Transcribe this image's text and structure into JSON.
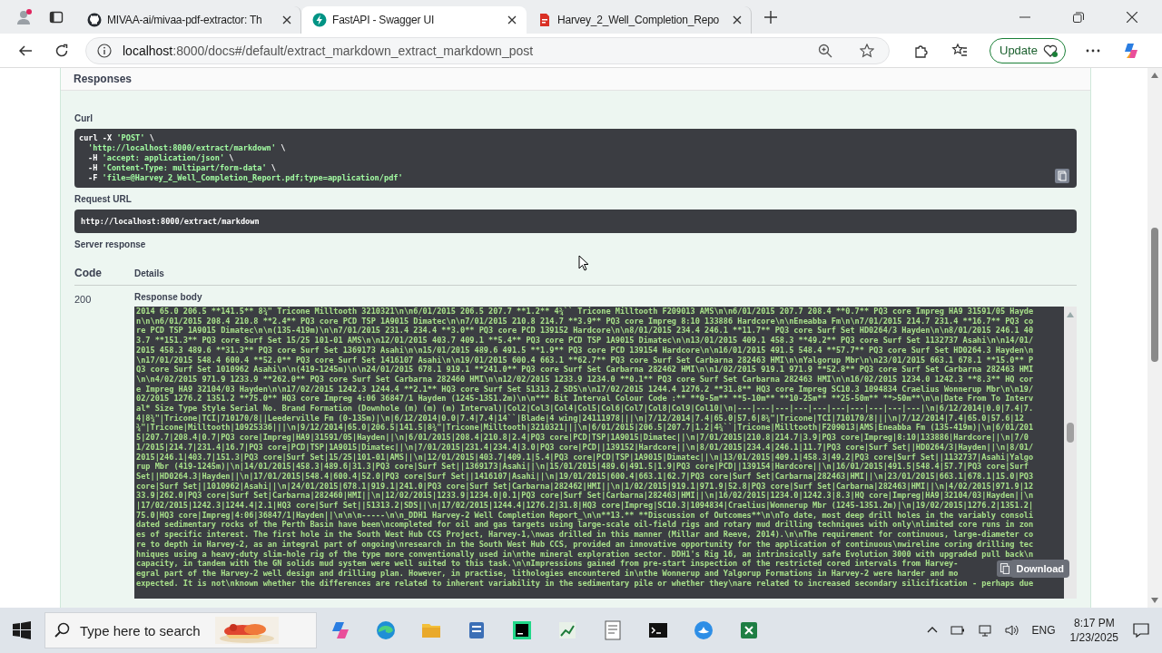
{
  "browser": {
    "tabs": [
      {
        "title": "MIVAA-ai/mivaa-pdf-extractor: Th",
        "selected": false,
        "kind": "repo"
      },
      {
        "title": "FastAPI - Swagger UI",
        "selected": true,
        "kind": "api"
      },
      {
        "title": "Harvey_2_Well_Completion_Repo",
        "selected": false,
        "kind": "pdf"
      }
    ],
    "address": {
      "host": "localhost",
      "path": ":8000/docs#/default/extract_markdown_extract_markdown_post"
    },
    "update_button": "Update"
  },
  "swagger": {
    "section_title": "Responses",
    "curl_label": "Curl",
    "curl_lines": [
      [
        {
          "text": "curl -X ",
          "kind": "plain"
        },
        {
          "text": "'POST'",
          "kind": "string"
        },
        {
          "text": " \\",
          "kind": "plain"
        }
      ],
      [
        {
          "text": "'http://localhost:8000/extract/markdown'",
          "kind": "string"
        },
        {
          "text": " \\",
          "kind": "plain"
        }
      ],
      [
        {
          "text": "-H ",
          "kind": "plain"
        },
        {
          "text": "'accept: application/json'",
          "kind": "string"
        },
        {
          "text": " \\",
          "kind": "plain"
        }
      ],
      [
        {
          "text": "-H ",
          "kind": "plain"
        },
        {
          "text": "'Content-Type: multipart/form-data'",
          "kind": "string"
        },
        {
          "text": " \\",
          "kind": "plain"
        }
      ],
      [
        {
          "text": "-F ",
          "kind": "plain"
        },
        {
          "text": "'file=@Harvey_2_Well_Completion_Report.pdf;type=application/pdf'",
          "kind": "string"
        }
      ]
    ],
    "request_url_label": "Request URL",
    "request_url": "http://localhost:8000/extract/markdown",
    "server_response_label": "Server response",
    "columns": [
      "Code",
      "Details"
    ],
    "code": "200",
    "response_body_label": "Response body",
    "response_body_lines": [
      "2014 65.0 206.5 **141.5** 8¾\" Tricone Milltooth 3210321\\n\\n6/01/2015 206.5 207.7 **1.2** 4¾`` Tricone Milltooth F209013 AMS\\n\\n6/01/2015 207.7 208.4 **0.7** PQ3 core Impreg HA9 31591/05 Hayde",
      "n\\n\\n6/01/2015 208.4 210.8 **2.4** PQ3 core PCD TSP 1A9015 Dimatec\\n\\n7/01/2015 210.8 214.7 **3.9** PQ3 core Impreg 8:10 133886 Hardcore\\n\\nEneabba Fm\\n\\n7/01/2015 214.7 231.4 **16.7** PQ3 co",
      "re PCD TSP 1A9015 Dimatec\\n\\n(135-419m)\\n\\n7/01/2015 231.4 234.4 **3.0** PQ3 core PCD 139152 Hardcore\\n\\n8/01/2015 234.4 246.1 **11.7** PQ3 core Surf Set HD0264/3 Hayden\\n\\n8/01/2015 246.1 40",
      "3.7 **151.3** PQ3 core Surf Set 15/25 101-01 AMS\\n\\n12/01/2015 403.7 409.1 **5.4** PQ3 core PCD TSP 1A9015 Dimatec\\n\\n13/01/2015 409.1 458.3 **49.2** PQ3 core Surf Set 1132737 Asahi\\n\\n14/01/",
      "2015 458.3 489.6 **31.3** PQ3 core Surf Set 1369173 Asahi\\n\\n15/01/2015 489.6 491.5 **1.9** PQ3 core PCD 139154 Hardcore\\n\\n16/01/2015 491.5 548.4 **57.7** PQ3 core Surf Set HD0264.3 Hayden\\n",
      "\\n17/01/2015 548.4 600.4 **52.0** PQ3 core Surf Set 1416107 Asahi\\n\\n19/01/2015 600.4 663.1 **62.7** PQ3 core Surf Set Carbarna 282463 HMI\\n\\nYalgorup Mbr\\n\\n23/01/2015 663.1 678.1 **15.0** P",
      "Q3 core Surf Set 1010962 Asahi\\n\\n(419-1245m)\\n\\n24/01/2015 678.1 919.1 **241.0** PQ3 core Surf Set Carbarna 282462 HMI\\n\\n1/02/2015 919.1 971.9 **52.8** PQ3 core Surf Set Carbarna 282463 HMI",
      "\\n\\n4/02/2015 971.9 1233.9 **262.0** PQ3 core Surf Set Carbarna 282460 HMI\\n\\n12/02/2015 1233.9 1234.0 **0.1** PQ3 core Surf Set Carbarna 282463 HMI\\n\\n16/02/2015 1234.0 1242.3 **8.3** HQ cor",
      "e Impreg HA9 32104/03 Hayden\\n\\n17/02/2015 1242.3 1244.4 **2.1** HQ3 core Surf Set 51313.2 SDS\\n\\n17/02/2015 1244.4 1276.2 **31.8** HQ3 core Impreg SC10.3 1094834 Craelius Wonnerup Mbr\\n\\n19/",
      "02/2015 1276.2 1351.2 **75.0** HQ3 core Impreg 4:06 36847/1 Hayden (1245-1351.2m)\\n\\n*** Bit Interval Colour Code :** **0-5m** **5-10m** **10-25m** **25-50m** **>50m**\\n\\n|Date From To Interv",
      "al* Size Type Style Serial No. Brand Formation (Downhole (m) (m) (m) Interval)|Col2|Col3|Col4|Col5|Col6|Col7|Col8|Col9|Col10|\\n|---|---|---|---|---|---|---|---|---|---|\\n|6/12/2014|0.0|7.4|7.",
      "4|8¾\"|Tricone|TCI|710170/8||Leederville Fm (0-135m)|\\n|6/12/2014|0.0|7.4|7.4|14``|Blade|4 wing|24111978|||\\n|7/12/2014|7.4|65.0|57.6|8¾\"|Tricone|TCI|710170/8|||\\n|7/12/2014|7.4|65.0|57.6|12",
      "¾\"|Tricone|Milltooth|10925336|||\\n|9/12/2014|65.0|206.5|141.5|8¾\"|Tricone|Milltooth|3210321|||\\n|6/01/2015|206.5|207.7|1.2|4¾``|Tricone|Milltooth|F209013|AMS|Eneabba Fm (135-419m)|\\n|6/01/201",
      "5|207.7|208.4|0.7|PQ3 core|Impreg|HA9|31591/05|Hayden||\\n|6/01/2015|208.4|210.8|2.4|PQ3 core|PCD|TSP|1A9015|Dimatec||\\n|7/01/2015|210.8|214.7|3.9|PQ3 core|Impreg|8:10|133886|Hardcore||\\n|7/0",
      "1/2015|214.7|231.4|16.7|PQ3 core|PCD|TSP|1A9015|Dimatec||\\n|7/01/2015|231.4|234.4|3.0|PQ3 core|PCD||139152|Hardcore||\\n|8/01/2015|234.4|246.1|11.7|PQ3 core|Surf Set||HD0264/3|Hayden||\\n|8/01/",
      "2015|246.1|403.7|151.3|PQ3 core|Surf Set|15/25|101-01|AMS||\\n|12/01/2015|403.7|409.1|5.4|PQ3 core|PCD|TSP|1A9015|Dimatec||\\n|13/01/2015|409.1|458.3|49.2|PQ3 core|Surf Set||1132737|Asahi|Yalgo",
      "rup Mbr (419-1245m)|\\n|14/01/2015|458.3|489.6|31.3|PQ3 core|Surf Set||1369173|Asahi||\\n|15/01/2015|489.6|491.5|1.9|PQ3 core|PCD||139154|Hardcore||\\n|16/01/2015|491.5|548.4|57.7|PQ3 core|Surf",
      "Set||HD0264.3|Hayden||\\n|17/01/2015|548.4|600.4|52.0|PQ3 core|Surf Set||1416107|Asahi||\\n|19/01/2015|600.4|663.1|62.7|PQ3 core|Surf Set|Carbarna|282463|HMI||\\n|23/01/2015|663.1|678.1|15.0|PQ3",
      "core|Surf Set||1010962|Asahi||\\n|24/01/2015|678.1|919.1|241.0|PQ3 core|Surf Set|Carbarna|282462|HMI||\\n|1/02/2015|919.1|971.9|52.8|PQ3 core|Surf Set|Carbarna|282463|HMI||\\n|4/02/2015|971.9|12",
      "33.9|262.0|PQ3 core|Surf Set|Carbarna|282460|HMI||\\n|12/02/2015|1233.9|1234.0|0.1|PQ3 core|Surf Set|Carbarna|282463|HMI||\\n|16/02/2015|1234.0|1242.3|8.3|HQ core|Impreg|HA9|32104/03|Hayden||\\n",
      "|17/02/2015|1242.3|1244.4|2.1|HQ3 core|Surf Set||51313.2|SDS||\\n|17/02/2015|1244.4|1276.2|31.8|HQ3 core|Impreg|SC10.3|1094834|Craelius|Wonnerup Mbr (1245-1351.2m)|\\n|19/02/2015|1276.2|1351.2|",
      "75.0|HQ3 core|Impreg|4:06|36847/1|Hayden||\\n\\n\\n-----\\n\\n_DDH1 Harvey-2 Well Completion Report_\\n\\n**13.** **Discussion of Outcomes**\\n\\nTo date, most deep drill holes in the variably consoli",
      "dated sedimentary rocks of the Perth Basin have been\\ncompleted for oil and gas targets using large-scale oil-field rigs and rotary mud drilling techniques with only\\nlimited core runs in zon",
      "es of specific interest. The first hole in the South West Hub CCS Project, Harvey-1,\\nwas drilled in this manner (Millar and Reeve, 2014).\\n\\nThe requirement for continuous, large-diameter co",
      "re to depth in Harvey-2, as an integral part of ongoing\\nresearch in the South West Hub CCS, provided an innovative opportunity for the application of continuous\\nwireline coring drilling tec",
      "hniques using a heavy-duty slim-hole rig of the type more conventionally used in\\nthe mineral exploration sector. DDH1's Rig 16, an intrinsically safe Evolution 3000 with upgraded pull back\\n",
      "capacity, in tandem with the GN solids mud system were well suited to this task.\\n\\nImpressions gained from pre-start inspection of the restricted cored intervals from Harvey-",
      "egral part of the Harvey-2 well design and drilling plan. However, in practise, lithologies encountered in\\nthe Wonnerup and Yalgorup Formations in Harvey-2 were harder and mo",
      "expected. It is not\\nknown whether the differences are related to inherent variability in the sedimentary pile or whether they\\nare related to increased secondary silicification - perhaps due"
    ],
    "download_button": "Download"
  },
  "taskbar": {
    "search_placeholder": "Type here to search",
    "language": "ENG",
    "time": "8:17 PM",
    "date": "1/23/2025"
  }
}
